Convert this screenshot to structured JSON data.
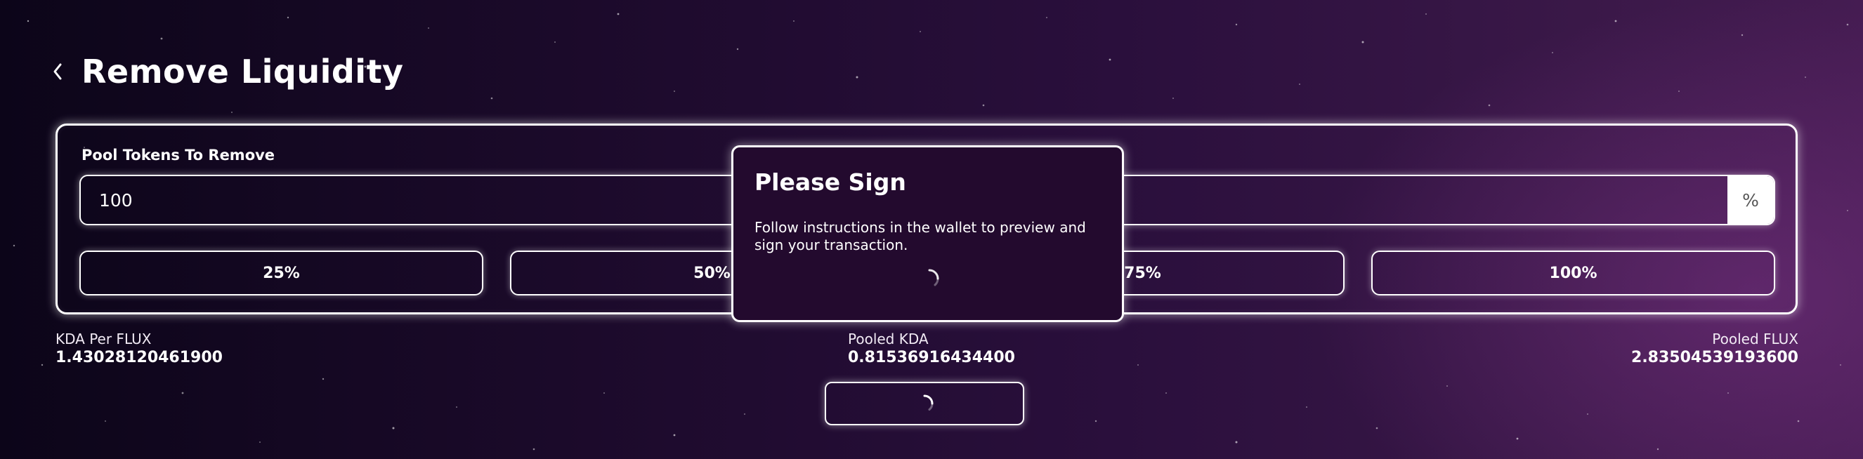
{
  "header": {
    "title": "Remove Liquidity"
  },
  "remove_form": {
    "label": "Pool Tokens To Remove",
    "amount_value": "100",
    "amount_placeholder": "",
    "unit_suffix": "%",
    "percent_buttons": [
      {
        "label": "25%"
      },
      {
        "label": "50%"
      },
      {
        "label": "75%"
      },
      {
        "label": "100%"
      }
    ]
  },
  "stats": {
    "rate": {
      "label": "KDA Per FLUX",
      "value": "1.43028120461900"
    },
    "pooled_kda": {
      "label": "Pooled KDA",
      "value": "0.81536916434400"
    },
    "pooled_flux": {
      "label": "Pooled FLUX",
      "value": "2.83504539193600"
    }
  },
  "modal": {
    "title": "Please Sign",
    "message": "Follow instructions in the wallet to preview and sign your transaction."
  },
  "icons": {
    "back": "chevron-left-icon",
    "loading": "spinner-icon"
  },
  "colors": {
    "accent": "#ffffff",
    "modal_background": "#230a2e",
    "percent_suffix_background": "#ffffff",
    "percent_suffix_text": "#555555"
  }
}
